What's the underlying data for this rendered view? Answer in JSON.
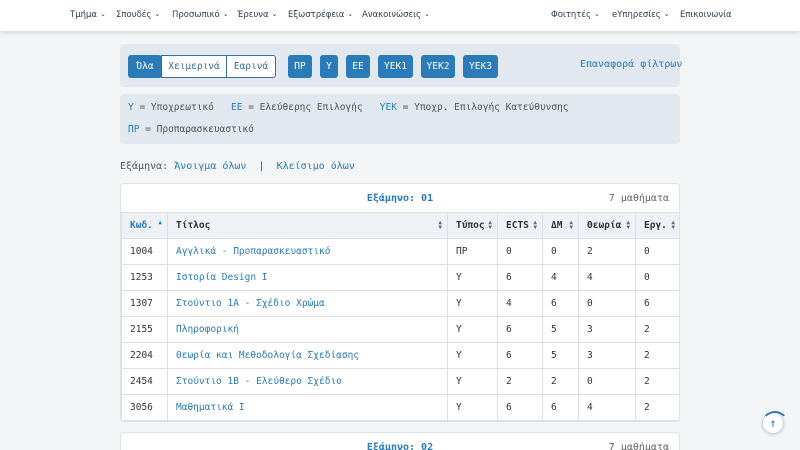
{
  "nav": {
    "left": [
      "Τμήμα",
      "Σπουδές",
      "Προσωπικό",
      "Έρευνα",
      "Εξωστρέφεια",
      "Ανακοινώσεις"
    ],
    "right": [
      "Φοιτητές",
      "eΥπηρεσίες",
      "Επικοινωνία"
    ]
  },
  "filters": {
    "segments": [
      "Όλα",
      "Χειμερινά",
      "Εαρινά"
    ],
    "types": [
      "ΠΡ",
      "Υ",
      "ΕΕ",
      "ΥΕΚ1",
      "ΥΕΚ2",
      "ΥΕΚ3"
    ],
    "reset": "Επαναφορά φίλτρων"
  },
  "legend": {
    "y_abbr": "Υ",
    "y_text": "= Υποχρεωτικό",
    "ee_abbr": "ΕΕ",
    "ee_text": "= Ελεύθερης Επιλογής",
    "yek_abbr": "ΥΕΚ",
    "yek_text": "= Υποχρ. Επιλογής Κατεύθυνσης",
    "pr_abbr": "ΠΡ",
    "pr_text": "= Προπαρασκευαστικό"
  },
  "semester_controls": {
    "label": "Εξάμηνα:",
    "open_all": "Άνοιγμα όλων",
    "separator": "|",
    "close_all": "Κλείσιμο όλων"
  },
  "semesters": [
    {
      "title": "Εξάμηνο: 01",
      "count": "7 μαθήματα",
      "columns": [
        "Κωδ.",
        "Τίτλος",
        "Τύπος",
        "ECTS",
        "ΔΜ",
        "Θεωρία",
        "Εργ."
      ],
      "rows": [
        [
          "1004",
          "Αγγλικά - Προπαρασκευαστικό",
          "ΠΡ",
          "0",
          "0",
          "2",
          "0"
        ],
        [
          "1253",
          "Ιστορία Design I",
          "Υ",
          "6",
          "4",
          "4",
          "0"
        ],
        [
          "1307",
          "Στούντιο 1Α - Σχέδιο Χρώμα",
          "Υ",
          "4",
          "6",
          "0",
          "6"
        ],
        [
          "2155",
          "Πληροφορική",
          "Υ",
          "6",
          "5",
          "3",
          "2"
        ],
        [
          "2204",
          "Θεωρία και Μεθοδολογία Σχεδίασης",
          "Υ",
          "6",
          "5",
          "3",
          "2"
        ],
        [
          "2454",
          "Στούντιο 1Β - Ελεύθερο Σχέδιο",
          "Υ",
          "2",
          "2",
          "0",
          "2"
        ],
        [
          "3056",
          "Μαθηματικά Ι",
          "Υ",
          "6",
          "6",
          "4",
          "2"
        ]
      ]
    },
    {
      "title": "Εξάμηνο: 02",
      "count": "7 μαθήματα"
    }
  ],
  "scroll_top_icon": "arrow-up-icon"
}
